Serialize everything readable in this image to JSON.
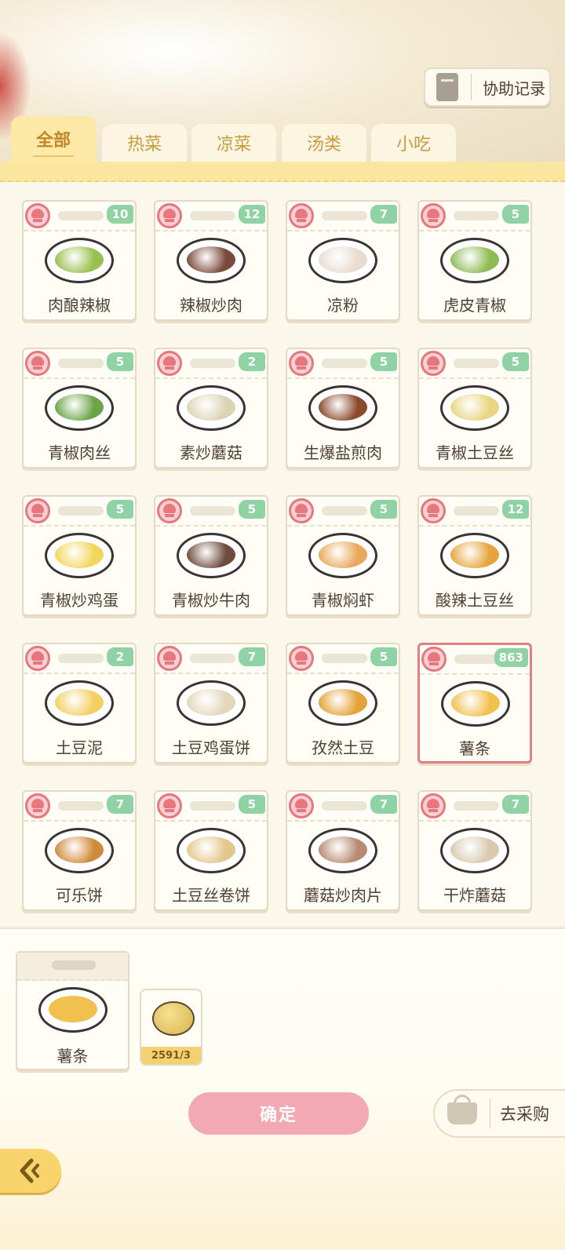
{
  "header": {
    "record_button_label": "协助记录",
    "record_icon": "notebook-icon"
  },
  "tabs": [
    {
      "label": "全部",
      "active": true
    },
    {
      "label": "热菜",
      "active": false
    },
    {
      "label": "凉菜",
      "active": false
    },
    {
      "label": "汤类",
      "active": false
    },
    {
      "label": "小吃",
      "active": false
    }
  ],
  "dishes": [
    {
      "name": "肉酿辣椒",
      "count": "10",
      "food_color": "#9ac04f"
    },
    {
      "name": "辣椒炒肉",
      "count": "12",
      "food_color": "#7a4a3a"
    },
    {
      "name": "凉粉",
      "count": "7",
      "food_color": "#e7dccf"
    },
    {
      "name": "虎皮青椒",
      "count": "5",
      "food_color": "#8fbb55"
    },
    {
      "name": "青椒肉丝",
      "count": "5",
      "food_color": "#6ba547"
    },
    {
      "name": "素炒蘑菇",
      "count": "2",
      "food_color": "#dcd3b5"
    },
    {
      "name": "生爆盐煎肉",
      "count": "5",
      "food_color": "#8a4a2e"
    },
    {
      "name": "青椒土豆丝",
      "count": "5",
      "food_color": "#e9d682"
    },
    {
      "name": "青椒炒鸡蛋",
      "count": "5",
      "food_color": "#f2d65a"
    },
    {
      "name": "青椒炒牛肉",
      "count": "5",
      "food_color": "#6e4b3e"
    },
    {
      "name": "青椒焖虾",
      "count": "5",
      "food_color": "#e9a85a"
    },
    {
      "name": "酸辣土豆丝",
      "count": "12",
      "food_color": "#e7a43b"
    },
    {
      "name": "土豆泥",
      "count": "2",
      "food_color": "#f3cf62"
    },
    {
      "name": "土豆鸡蛋饼",
      "count": "7",
      "food_color": "#e2d7b9"
    },
    {
      "name": "孜然土豆",
      "count": "5",
      "food_color": "#e4a238"
    },
    {
      "name": "薯条",
      "count": "863",
      "food_color": "#f2c04e",
      "selected": true
    },
    {
      "name": "可乐饼",
      "count": "7",
      "food_color": "#d08a3a"
    },
    {
      "name": "土豆丝卷饼",
      "count": "5",
      "food_color": "#e3c78a"
    },
    {
      "name": "蘑菇炒肉片",
      "count": "7",
      "food_color": "#b88a72"
    },
    {
      "name": "干炸蘑菇",
      "count": "7",
      "food_color": "#d9c9ad"
    }
  ],
  "selected_dish": {
    "name": "薯条"
  },
  "ingredient": {
    "quantity": "2591/3",
    "icon": "potato-icon"
  },
  "actions": {
    "confirm_label": "确定",
    "shop_label": "去采购",
    "shop_icon": "basket-icon",
    "back_icon": "back-arrow-icon"
  },
  "colors": {
    "accent": "#fde9a6",
    "count_badge": "#8fd2a3",
    "confirm": "#f3a9b3",
    "selected_border": "#e37f84"
  }
}
